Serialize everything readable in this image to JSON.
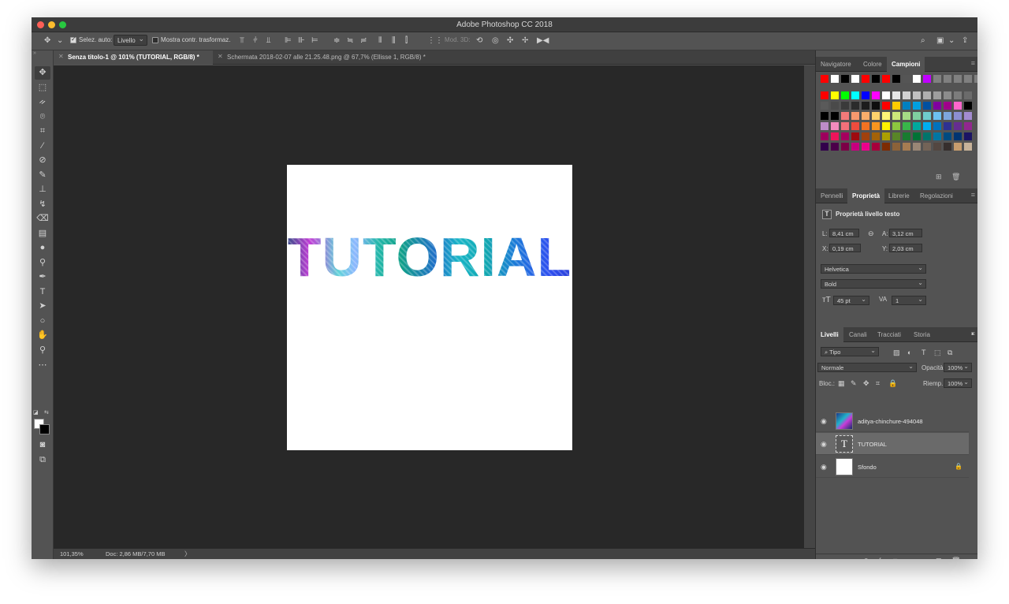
{
  "window": {
    "title": "Adobe Photoshop CC 2018"
  },
  "options_bar": {
    "auto_select_label": "Selez. auto:",
    "auto_select_checked": true,
    "auto_select_target": "Livello",
    "show_transform_label": "Mostra contr. trasformaz.",
    "mode_3d_label": "Mod. 3D:"
  },
  "doc_tabs": [
    {
      "label": "Senza titolo-1 @ 101% (TUTORIAL, RGB/8) *",
      "active": true
    },
    {
      "label": "Schermata 2018-02-07 alle 21.25.48.png @ 67,7% (Ellisse 1, RGB/8) *",
      "active": false
    }
  ],
  "canvas": {
    "text": "TUTORIAL"
  },
  "status_bar": {
    "zoom": "101,35%",
    "doc_info": "Doc: 2,86 MB/7,70 MB",
    "arrow": "〉"
  },
  "swatches_panel": {
    "tabs": [
      "Navigatore",
      "Colore",
      "Campioni"
    ],
    "active_tab": "Campioni",
    "recent_colors": [
      "#ff0000",
      "#ffffff",
      "#000000",
      "#ffffff",
      "#ff0000",
      "#000000",
      "#ff0000",
      "#000000",
      "#555555",
      "#ffffff",
      "#c000ff",
      "#808080",
      "#808080",
      "#808080",
      "#808080",
      "#808080"
    ],
    "rows": [
      [
        "#ff0000",
        "#ffff00",
        "#00ff00",
        "#00ffff",
        "#0000ff",
        "#ff00ff",
        "#ffffff",
        "#e6e6e6",
        "#d2d2d2",
        "#c0c0c0",
        "#afafaf",
        "#9e9e9e",
        "#8c8c8c",
        "#7c7c7c",
        "#6b6b6b"
      ],
      [
        "#5a5a5a",
        "#4a4a4a",
        "#3a3a3a",
        "#2b2b2b",
        "#1c1c1c",
        "#0d0d0d",
        "#ff0000",
        "#ffcc00",
        "#0080c0",
        "#00a0e0",
        "#0050a0",
        "#8000a0",
        "#a0008b",
        "#ff66cc",
        "#000000"
      ],
      [
        "#000000",
        "#000000",
        "#f47a7a",
        "#f6986e",
        "#f9ad6b",
        "#fdd26c",
        "#fff577",
        "#cde87a",
        "#a5dc85",
        "#7fd0a0",
        "#6fcbcc",
        "#6dc0f0",
        "#7ea6dd",
        "#8c8fd2",
        "#a38cd0"
      ],
      [
        "#bd8cc8",
        "#f28bbd",
        "#f2707a",
        "#ef4c3e",
        "#f27222",
        "#f7951f",
        "#fff200",
        "#8dc63f",
        "#39b54a",
        "#00a99d",
        "#00aeef",
        "#0072bc",
        "#2e3192",
        "#662d91",
        "#92278f"
      ],
      [
        "#9e005d",
        "#ed145b",
        "#a5005e",
        "#9e0b0f",
        "#a0410d",
        "#a36209",
        "#aba000",
        "#598527",
        "#197b30",
        "#007236",
        "#00746b",
        "#0076a3",
        "#004a80",
        "#003471",
        "#1b1464"
      ],
      [
        "#32004b",
        "#4b0049",
        "#7b0046",
        "#c7007e",
        "#ec008c",
        "#a7003b",
        "#7d2b03",
        "#8c6239",
        "#a67c52",
        "#998675",
        "#736357",
        "#534741",
        "#362f2d",
        "#c69c6d",
        "#c7b299"
      ]
    ]
  },
  "properties_panel": {
    "tabs": [
      "Pennelli",
      "Proprietà",
      "Librerie",
      "Regolazioni"
    ],
    "active_tab": "Proprietà",
    "header": "Proprietà livello testo",
    "L_label": "L:",
    "L_value": "8,41 cm",
    "A_label": "A:",
    "A_value": "3,12 cm",
    "X_label": "X:",
    "X_value": "0,19 cm",
    "Y_label": "Y:",
    "Y_value": "2,03 cm",
    "font_family": "Helvetica",
    "font_style": "Bold",
    "font_size": "45 pt",
    "tracking": "1"
  },
  "layers_panel": {
    "tabs": [
      "Livelli",
      "Canali",
      "Tracciati",
      "Storia"
    ],
    "active_tab": "Livelli",
    "filter": "Tipo",
    "blend_mode": "Normale",
    "opacity_label": "Opacità:",
    "opacity_value": "100%",
    "lock_label": "Bloc.:",
    "fill_label": "Riemp.:",
    "fill_value": "100%",
    "layers": [
      {
        "name": "aditya-chinchure-494048",
        "selected": false
      },
      {
        "name": "TUTORIAL",
        "selected": true,
        "thumb_glyph": "T"
      },
      {
        "name": "Sfondo",
        "selected": false
      }
    ]
  }
}
